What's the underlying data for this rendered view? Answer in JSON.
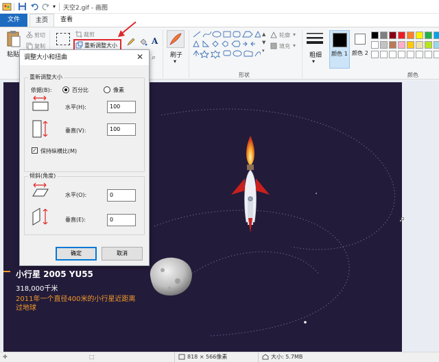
{
  "window": {
    "title": "天空2.gif - 画图"
  },
  "tabs": {
    "file": "文件",
    "home": "主页",
    "view": "查看"
  },
  "ribbon": {
    "paste": "粘贴",
    "cut": "剪切",
    "copy": "复制",
    "crop": "裁剪",
    "resize": "重新调整大小",
    "brush": "刷子",
    "outline": "轮廓",
    "fill": "填充",
    "size": "粗细",
    "color1": "颜色 1",
    "color2": "颜色 2",
    "shapes_group": "形状",
    "colors_group": "颜色",
    "palette_row1": [
      "#000000",
      "#7f7f7f",
      "#880015",
      "#ed1c24",
      "#ff7f27",
      "#fff200",
      "#22b14c",
      "#00a2e8",
      "#3f48cc",
      "#a349a4"
    ],
    "palette_row2": [
      "#ffffff",
      "#c3c3c3",
      "#b97a57",
      "#ffaec9",
      "#ffc90e",
      "#efe4b0",
      "#b5e61d",
      "#99d9ea",
      "#7092be",
      "#c8bfe7"
    ]
  },
  "dialog": {
    "title": "调整大小和扭曲",
    "resize_section": "重新调整大小",
    "by": "依据(B):",
    "percent": "百分比",
    "pixels": "像素",
    "horizontal_h": "水平(H):",
    "horizontal_h_value": "100",
    "vertical_v": "垂直(V):",
    "vertical_v_value": "100",
    "keep_ratio": "保持纵横比(M)",
    "skew_section": "倾斜(角度)",
    "horizontal_o": "水平(O):",
    "horizontal_o_value": "0",
    "vertical_e": "垂直(E):",
    "vertical_e_value": "0",
    "ok": "确定",
    "cancel": "取消"
  },
  "image": {
    "asteroid_title": "小行星 2005 YU55",
    "distance": "318,000千米",
    "desc_line1": "2011年一个直径400米的小行星近距离",
    "desc_line2": "过地球"
  },
  "status": {
    "dimensions": "818 × 566像素",
    "size": "大小: 5.7MB"
  }
}
